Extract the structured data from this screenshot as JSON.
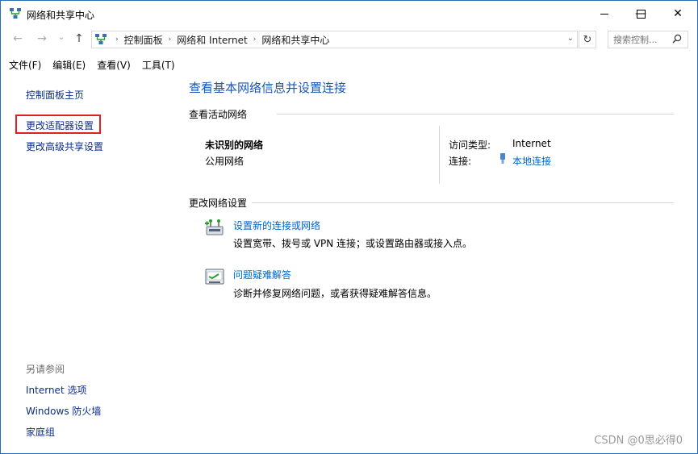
{
  "window": {
    "title": "网络和共享中心",
    "minimize_glyph": "—",
    "maximize_glyph": "☐",
    "close_glyph": "✕"
  },
  "nav": {
    "back_glyph": "←",
    "forward_glyph": "→",
    "history_glyph": "⌄",
    "up_glyph": "↑",
    "breadcrumbs": [
      "控制面板",
      "网络和 Internet",
      "网络和共享中心"
    ],
    "separator": "›",
    "dropdown_glyph": "⌄",
    "refresh_glyph": "↻",
    "search_placeholder": "搜索控制..."
  },
  "menu": [
    "文件(F)",
    "编辑(E)",
    "查看(V)",
    "工具(T)"
  ],
  "sidebar": {
    "home": "控制面板主页",
    "adapter": "更改适配器设置",
    "advanced": "更改高级共享设置",
    "see_also": "另请参阅",
    "links": [
      "Internet 选项",
      "Windows 防火墙",
      "家庭组"
    ]
  },
  "main": {
    "title": "查看基本网络信息并设置连接",
    "active_heading": "查看活动网络",
    "network_name": "未识别的网络",
    "network_type": "公用网络",
    "access_label": "访问类型:",
    "access_value": "Internet",
    "conn_label": "连接:",
    "conn_value": "本地连接",
    "change_heading": "更改网络设置",
    "tasks": [
      {
        "title": "设置新的连接或网络",
        "desc": "设置宽带、拨号或 VPN 连接；或设置路由器或接入点。"
      },
      {
        "title": "问题疑难解答",
        "desc": "诊断并修复网络问题，或者获得疑难解答信息。"
      }
    ]
  },
  "watermark": "CSDN @0思必得0",
  "colors": {
    "accent": "#1a57b5",
    "link": "#0066cc",
    "highlight": "#e02020"
  }
}
